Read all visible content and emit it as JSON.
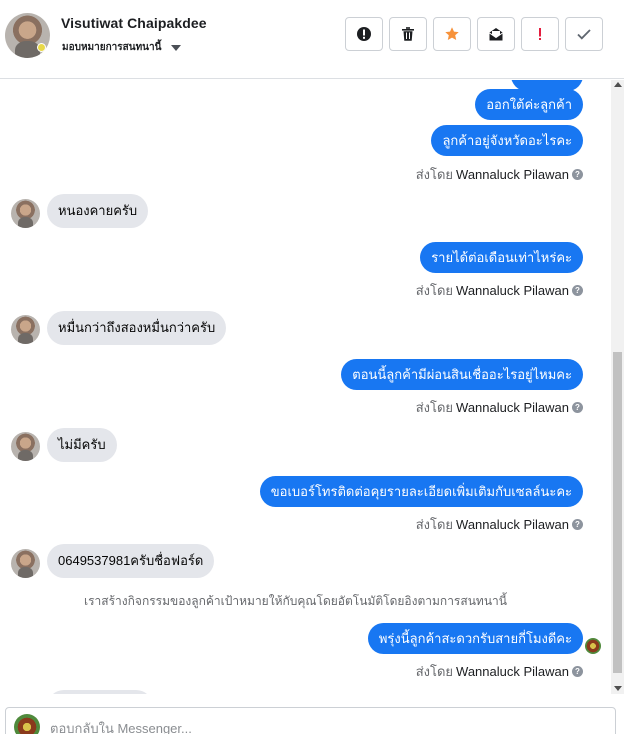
{
  "header": {
    "contact_name": "Visutiwat Chaipakdee",
    "assign_label": "มอบหมายการสนทนานี้",
    "toolbar": [
      {
        "name": "alert-circle",
        "color": "#1c1e21"
      },
      {
        "name": "trash",
        "color": "#1c1e21"
      },
      {
        "name": "star",
        "color": "#f7923a"
      },
      {
        "name": "mark-unread",
        "color": "#1c1e21"
      },
      {
        "name": "important",
        "color": "#e41e3f"
      },
      {
        "name": "check",
        "color": "#606770"
      }
    ]
  },
  "conversation": {
    "out_1": "ออกใต้ค่ะลูกค้า",
    "out_2": "ลูกค้าอยู่จังหวัดอะไรคะ",
    "sent_by_prefix": "ส่งโดย",
    "sender": "Wannaluck Pilawan",
    "in_1": "หนองคายครับ",
    "out_3": "รายได้ต่อเดือนเท่าไหร่คะ",
    "in_2": "หมื่นกว่าถึงสองหมื่นกว่าครับ",
    "out_4": "ตอนนี้ลูกค้ามีผ่อนสินเชื่ออะไรอยู่ไหมคะ",
    "in_3": "ไม่มีครับ",
    "out_5": "ขอเบอร์โทรติดต่อคุยรายละเอียดเพิ่มเติมกับเซลล์นะคะ",
    "in_4": "0649537981ครับชื่อฟอร์ด",
    "system_note": "เราสร้างกิจกรรมของลูกค้าเป้าหมายให้กับคุณโดยอัตโนมัติโดยอิงตามการสนทนานี้",
    "out_6": "พรุ่งนี้ลูกค้าสะดวกรับสายกี่โมงดีคะ",
    "help_glyph": "?"
  },
  "composer": {
    "placeholder": "ตอบกลับใน Messenger..."
  },
  "colors": {
    "outgoing_bubble": "#1877f2",
    "incoming_bubble": "#e4e6eb"
  }
}
